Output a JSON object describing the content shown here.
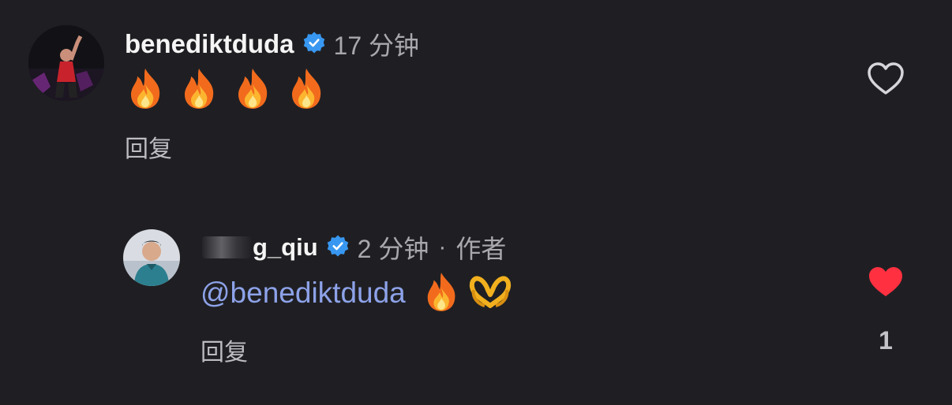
{
  "comments": [
    {
      "username": "benediktdudа",
      "time": "17 分钟",
      "body_emojis": [
        "fire",
        "fire",
        "fire",
        "fire"
      ],
      "reply_label": "回复",
      "liked": false
    },
    {
      "username_visible": "g_qiu",
      "time": "2 分钟",
      "separator": "·",
      "author_badge": "作者",
      "mention": "@benediktduda",
      "body_emojis": [
        "fire",
        "heart-hands"
      ],
      "reply_label": "回复",
      "liked": true,
      "like_count": "1"
    }
  ],
  "colors": {
    "background": "#1f1f23",
    "mention": "#8da2e8",
    "like_active": "#ff3040",
    "verified": "#3897f0"
  }
}
